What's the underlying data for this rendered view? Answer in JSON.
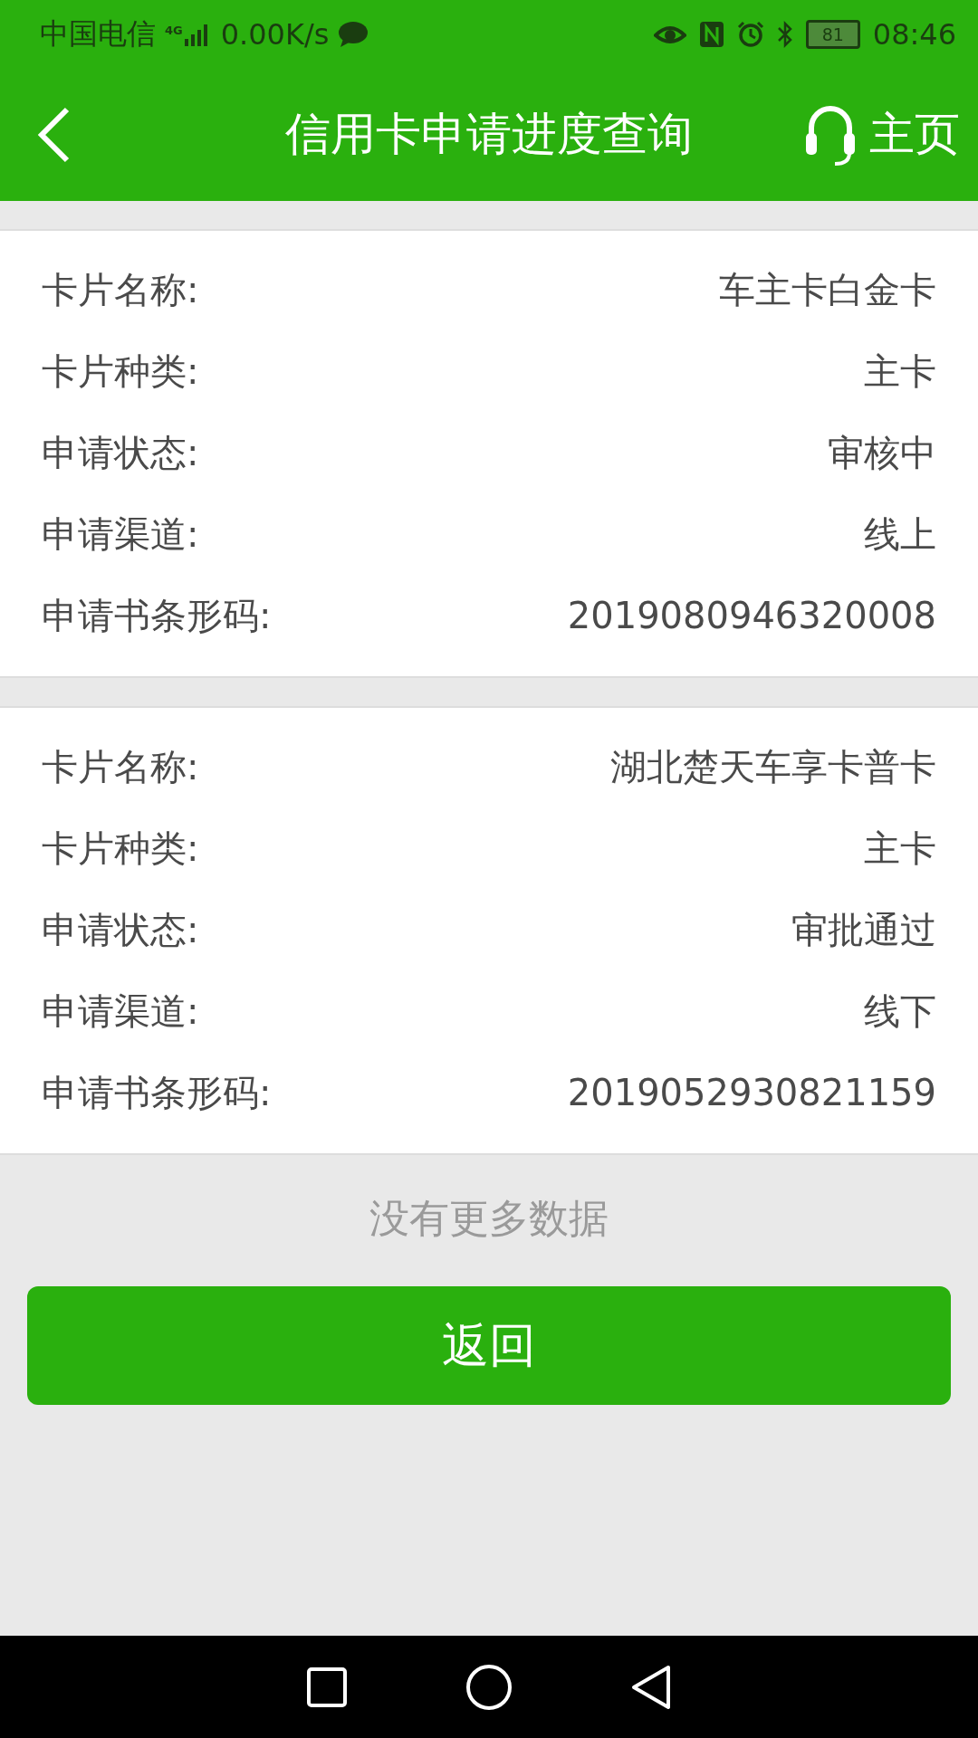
{
  "status_bar": {
    "carrier": "中国电信",
    "network": "4G",
    "speed": "0.00K/s",
    "battery": "81",
    "time": "08:46"
  },
  "header": {
    "title": "信用卡申请进度查询",
    "home": "主页"
  },
  "cards": [
    {
      "rows": [
        {
          "label": "卡片名称:",
          "value": "车主卡白金卡"
        },
        {
          "label": "卡片种类:",
          "value": "主卡"
        },
        {
          "label": "申请状态:",
          "value": "审核中"
        },
        {
          "label": "申请渠道:",
          "value": "线上"
        },
        {
          "label": "申请书条形码:",
          "value": "2019080946320008"
        }
      ]
    },
    {
      "rows": [
        {
          "label": "卡片名称:",
          "value": "湖北楚天车享卡普卡"
        },
        {
          "label": "卡片种类:",
          "value": "主卡"
        },
        {
          "label": "申请状态:",
          "value": "审批通过"
        },
        {
          "label": "申请渠道:",
          "value": "线下"
        },
        {
          "label": "申请书条形码:",
          "value": "2019052930821159"
        }
      ]
    }
  ],
  "footer_note": "没有更多数据",
  "back_button": "返回"
}
